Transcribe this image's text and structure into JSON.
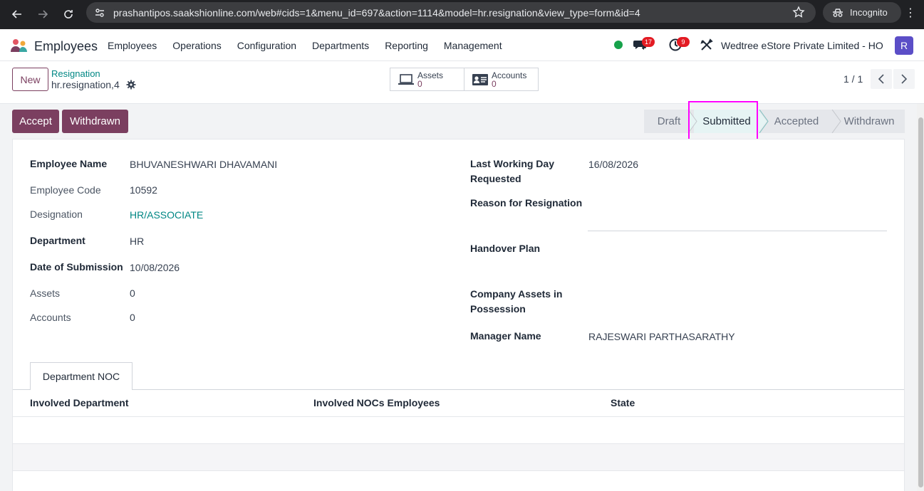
{
  "browser": {
    "url": "prashantipos.saakshionline.com/web#cids=1&menu_id=697&action=1114&model=hr.resignation&view_type=form&id=4",
    "incognito_label": "Incognito"
  },
  "navbar": {
    "app_name": "Employees",
    "menu": [
      "Employees",
      "Operations",
      "Configuration",
      "Departments",
      "Reporting",
      "Management"
    ],
    "chat_badge": "17",
    "activity_badge": "9",
    "company": "Wedtree eStore Private Limited - HO",
    "avatar_letter": "R"
  },
  "control_panel": {
    "new_label": "New",
    "breadcrumb_parent": "Resignation",
    "breadcrumb_current": "hr.resignation,4",
    "smart_buttons": [
      {
        "label": "Assets",
        "value": "0"
      },
      {
        "label": "Accounts",
        "value": "0"
      }
    ],
    "pager": "1 / 1"
  },
  "actions": {
    "accept_label": "Accept",
    "withdrawn_label": "Withdrawn"
  },
  "stages": {
    "items": [
      "Draft",
      "Submitted",
      "Accepted",
      "Withdrawn"
    ],
    "active": "Submitted"
  },
  "form": {
    "left": [
      {
        "label": "Employee Name",
        "value": "BHUVANESHWARI DHAVAMANI"
      },
      {
        "label": "Employee Code",
        "value": "10592"
      },
      {
        "label": "Designation",
        "value": "HR/ASSOCIATE"
      },
      {
        "label": "Department",
        "value": "HR"
      },
      {
        "label": "Date of Submission",
        "value": "10/08/2026"
      },
      {
        "label": "Assets",
        "value": "0"
      },
      {
        "label": "Accounts",
        "value": "0"
      }
    ],
    "right": [
      {
        "label": "Last Working Day Requested",
        "value": "16/08/2026"
      },
      {
        "label": "Reason for Resignation",
        "value": ""
      },
      {
        "label": "Handover Plan",
        "value": ""
      },
      {
        "label": "Company Assets in Possession",
        "value": ""
      },
      {
        "label": "Manager Name",
        "value": "RAJESWARI PARTHASARATHY"
      }
    ]
  },
  "notebook": {
    "tab_label": "Department NOC",
    "columns": [
      "Involved Department",
      "Involved NOCs Employees",
      "State"
    ]
  },
  "colors": {
    "primary": "#7b3f60",
    "link": "#008784",
    "highlight": "#ff00ff"
  }
}
